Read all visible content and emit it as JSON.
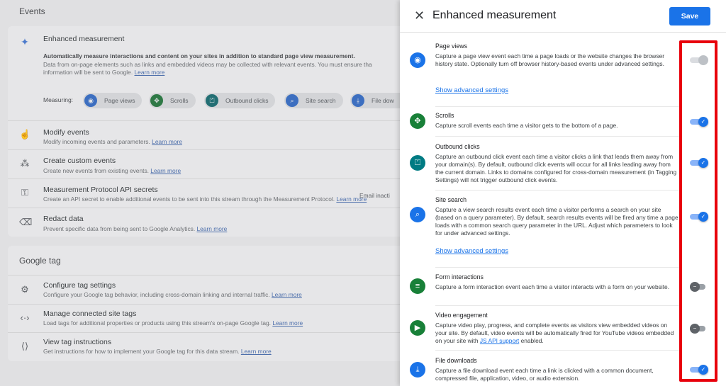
{
  "colors": {
    "accent": "#1a73e8",
    "highlight": "#e8000b",
    "green": "#188038",
    "teal": "#007b83"
  },
  "background": {
    "events_header": "Events",
    "enhanced": {
      "title": "Enhanced measurement",
      "bold_text": "Automatically measure interactions and content on your sites in addition to standard page view measurement.",
      "text_line1": "Data from on-page elements such as links and embedded videos may be collected with relevant events. You must ensure tha",
      "text_line2": "information will be sent to Google.",
      "learn_more": "Learn more",
      "measuring_label": "Measuring:",
      "chips": [
        {
          "label": "Page views",
          "icon": "eye-icon"
        },
        {
          "label": "Scrolls",
          "icon": "crosshair-icon"
        },
        {
          "label": "Outbound clicks",
          "icon": "mouse-icon"
        },
        {
          "label": "Site search",
          "icon": "search-icon"
        },
        {
          "label": "File dow",
          "icon": "download-icon"
        }
      ]
    },
    "rows": [
      {
        "title": "Modify events",
        "desc": "Modify incoming events and parameters.",
        "link": "Learn more",
        "icon": "touch-icon"
      },
      {
        "title": "Create custom events",
        "desc": "Create new events from existing events.",
        "link": "Learn more",
        "icon": "sparkle-cursor-icon"
      },
      {
        "title": "Measurement Protocol API secrets",
        "desc": "Create an API secret to enable additional events to be sent into this stream through the Measurement Protocol.",
        "link": "Learn more",
        "icon": "key-icon"
      },
      {
        "title": "Redact data",
        "desc": "Prevent specific data from being sent to Google Analytics.",
        "link": "Learn more",
        "icon": "eraser-icon"
      }
    ],
    "email_status": "Email inacti",
    "gtag_header": "Google tag",
    "gtag_rows": [
      {
        "title": "Configure tag settings",
        "desc": "Configure your Google tag behavior, including cross-domain linking and internal traffic.",
        "link": "Learn more",
        "icon": "tag-settings-icon"
      },
      {
        "title": "Manage connected site tags",
        "desc": "Load tags for additional properties or products using this stream's on-page Google tag.",
        "link": "Learn more",
        "icon": "code-icon"
      },
      {
        "title": "View tag instructions",
        "desc": "Get instructions for how to implement your Google tag for this data stream.",
        "link": "Learn more",
        "icon": "tag-code-icon"
      }
    ]
  },
  "panel": {
    "title": "Enhanced measurement",
    "save_label": "Save",
    "items": [
      {
        "title": "Page views",
        "desc": "Capture a page view event each time a page loads or the website changes the browser history state. Optionally turn off browser history-based events under advanced settings.",
        "advanced": "Show advanced settings",
        "icon": "eye-icon",
        "color": "#1a73e8",
        "state": "disabled"
      },
      {
        "title": "Scrolls",
        "desc": "Capture scroll events each time a visitor gets to the bottom of a page.",
        "icon": "crosshair-icon",
        "color": "#188038",
        "state": "on"
      },
      {
        "title": "Outbound clicks",
        "desc": "Capture an outbound click event each time a visitor clicks a link that leads them away from your domain(s). By default, outbound click events will occur for all links leading away from the current domain. Links to domains configured for cross-domain measurement (in Tagging Settings) will not trigger outbound click events.",
        "icon": "mouse-icon",
        "color": "#007b83",
        "state": "on"
      },
      {
        "title": "Site search",
        "desc": "Capture a view search results event each time a visitor performs a search on your site (based on a query parameter). By default, search results events will be fired any time a page loads with a common search query parameter in the URL. Adjust which parameters to look for under advanced settings.",
        "advanced": "Show advanced settings",
        "icon": "search-icon",
        "color": "#1a73e8",
        "state": "on"
      },
      {
        "title": "Form interactions",
        "desc": "Capture a form interaction event each time a visitor interacts with a form on your website.",
        "icon": "form-icon",
        "color": "#188038",
        "state": "off"
      },
      {
        "title": "Video engagement",
        "desc_pre": "Capture video play, progress, and complete events as visitors view embedded videos on your site. By default, video events will be automatically fired for YouTube videos embedded on your site with ",
        "desc_link": "JS API support",
        "desc_post": " enabled.",
        "icon": "play-icon",
        "color": "#188038",
        "state": "off"
      },
      {
        "title": "File downloads",
        "desc": "Capture a file download event each time a link is clicked with a common document, compressed file, application, video, or audio extension.",
        "icon": "download-icon",
        "color": "#1a73e8",
        "state": "on"
      }
    ]
  }
}
